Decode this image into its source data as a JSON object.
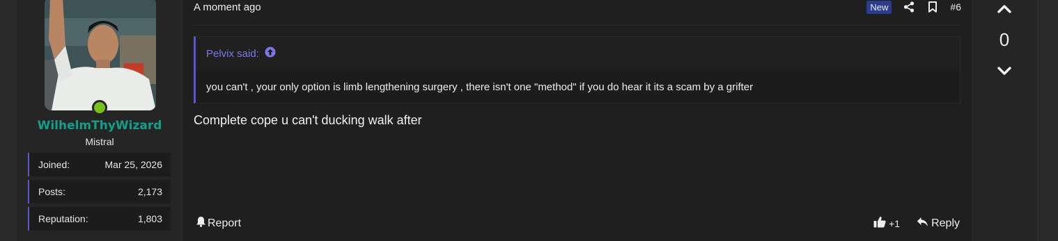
{
  "post": {
    "time": "A moment ago",
    "badge": "New",
    "number": "#6",
    "quote": {
      "author": "Pelvix said:",
      "text": "you can't , your only option is limb lengthening surgery , there isn't one \"method\" if you do hear it its a scam by a grifter"
    },
    "message": "Complete cope u can't ducking walk after",
    "report_label": "Report",
    "like_count": "+1",
    "reply_label": "Reply"
  },
  "user": {
    "name": "WilhelmThyWizard",
    "title": "Mistral",
    "online": true,
    "stats": [
      {
        "label": "Joined:",
        "value": "Mar 25, 2026"
      },
      {
        "label": "Posts:",
        "value": "2,173"
      },
      {
        "label": "Reputation:",
        "value": "1,803"
      }
    ]
  },
  "vote": {
    "score": "0"
  },
  "icons": {
    "share": "share-icon",
    "bookmark": "bookmark-icon",
    "quote_up": "arrow-up-circle-icon",
    "report": "bell-icon",
    "like": "thumbs-up-icon",
    "reply": "reply-icon",
    "vote_up": "chevron-up-icon",
    "vote_down": "chevron-down-icon"
  },
  "colors": {
    "username": "#12a08a",
    "accent": "#5c58c8",
    "quote_author": "#7d78e8",
    "online": "#7bbf1a",
    "new_badge": "#2c3d8c"
  }
}
